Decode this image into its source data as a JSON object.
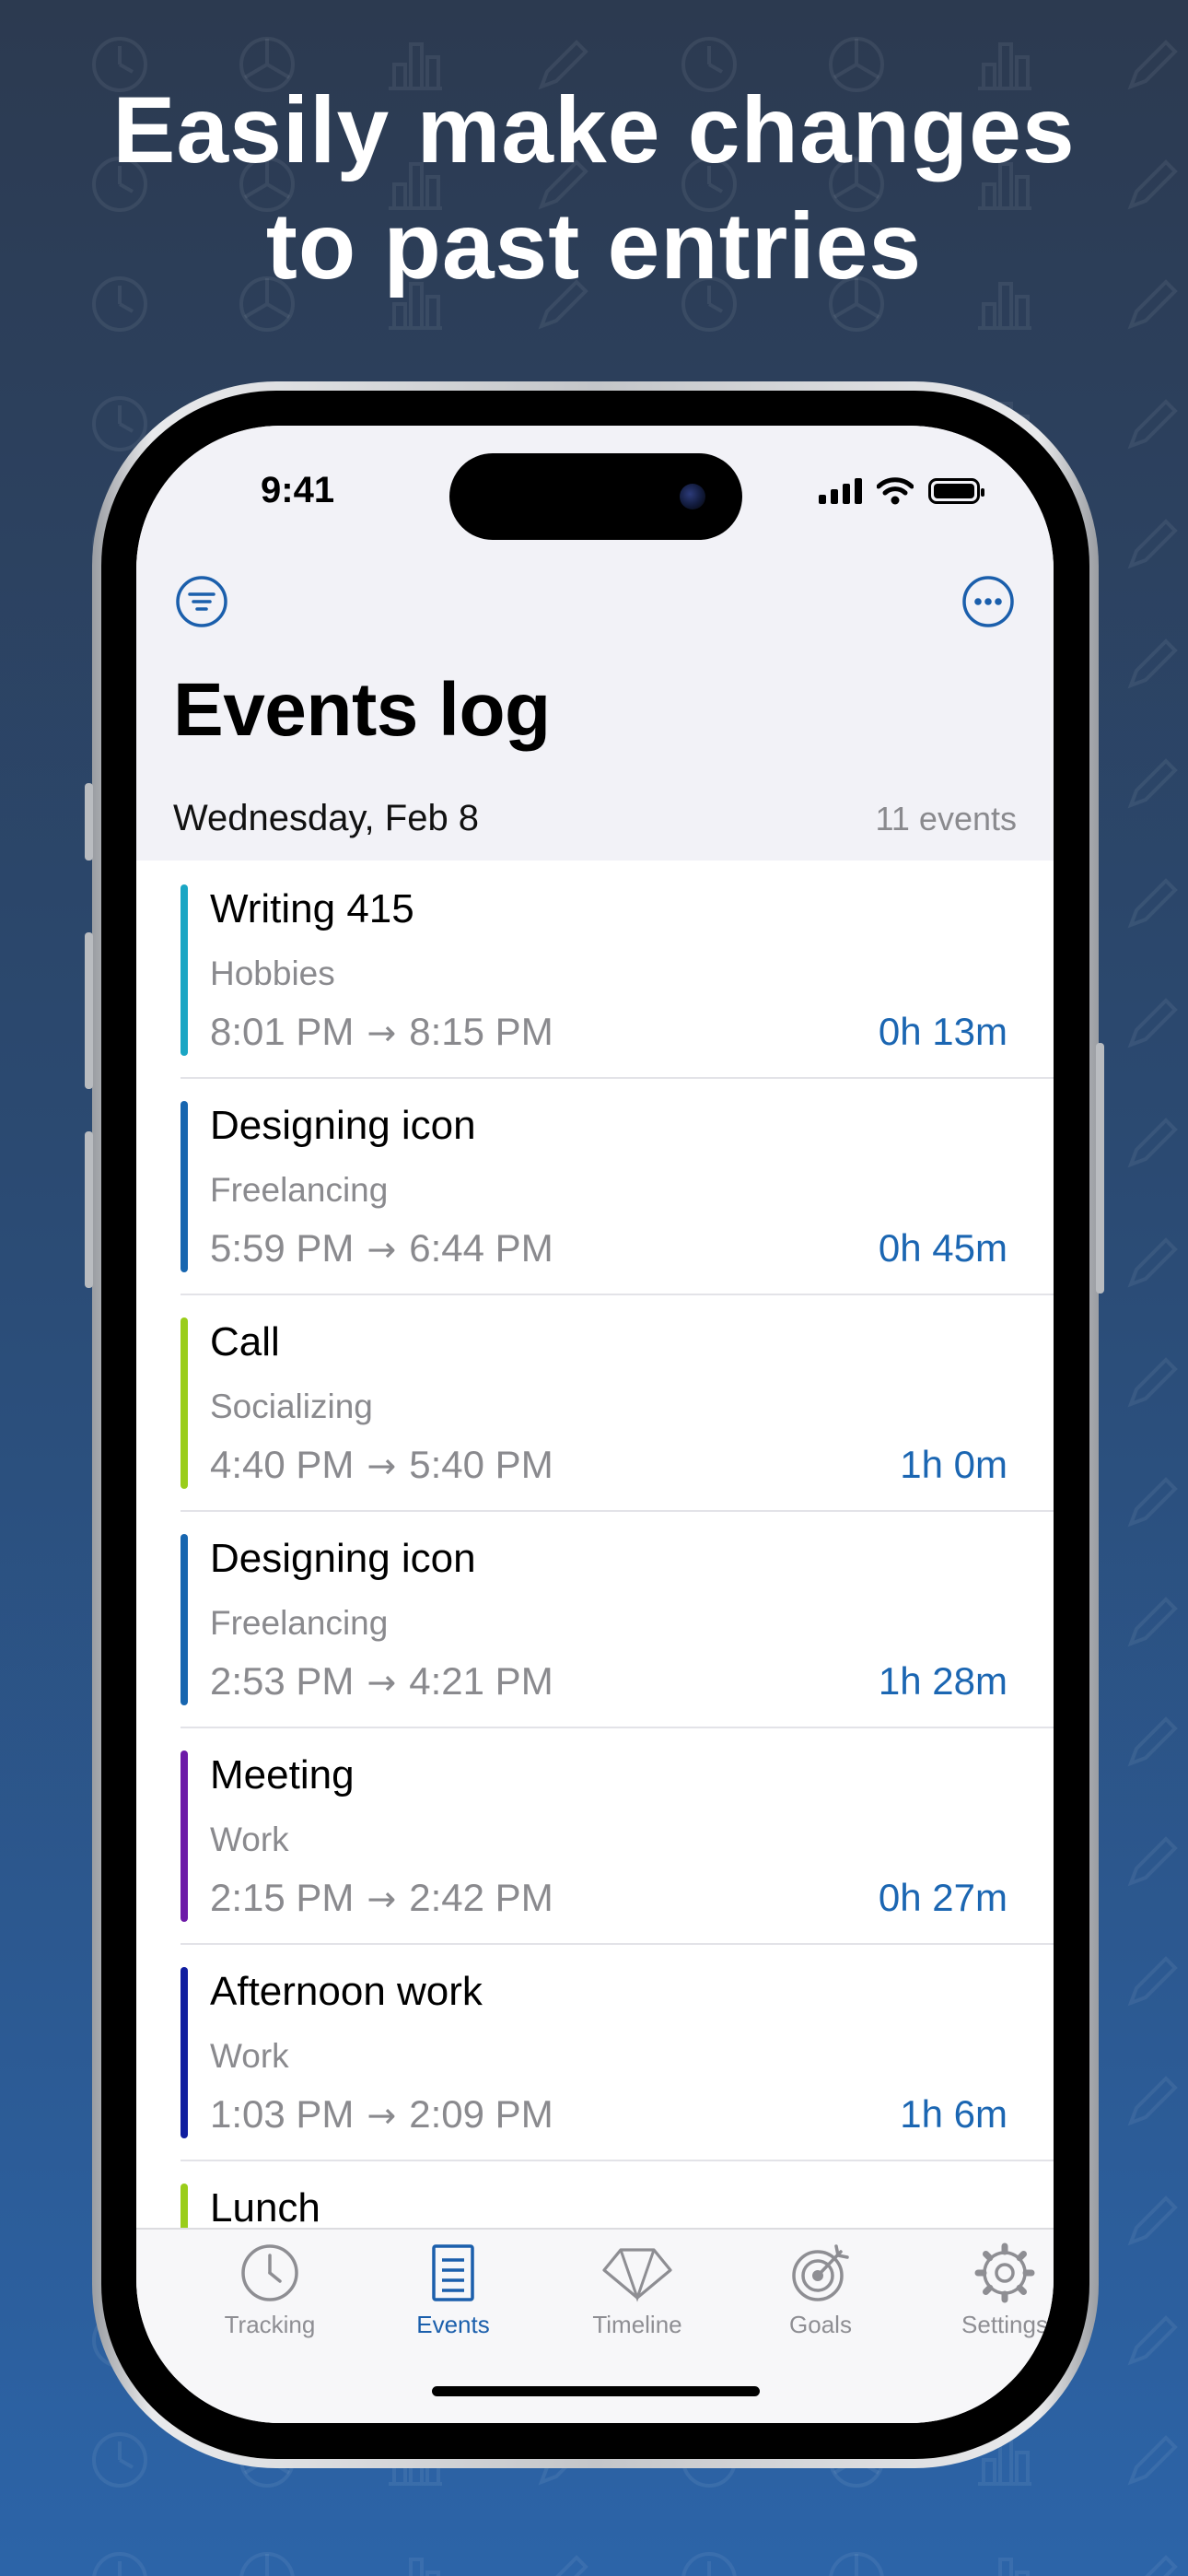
{
  "headline": {
    "line1": "Easily make changes",
    "line2": "to past entries"
  },
  "status_bar": {
    "time": "9:41"
  },
  "nav": {
    "left_icon": "filter-icon",
    "right_icon": "more-icon"
  },
  "page": {
    "title": "Events log"
  },
  "section": {
    "date": "Wednesday, Feb 8",
    "count": "11 events"
  },
  "events": [
    {
      "title": "Writing 415",
      "category": "Hobbies",
      "start": "8:01 PM",
      "end": "8:15 PM",
      "duration": "0h 13m",
      "color": "#1aa6c4"
    },
    {
      "title": "Designing icon",
      "category": "Freelancing",
      "start": "5:59 PM",
      "end": "6:44 PM",
      "duration": "0h 45m",
      "color": "#1766b0"
    },
    {
      "title": "Call",
      "category": "Socializing",
      "start": "4:40 PM",
      "end": "5:40 PM",
      "duration": "1h 0m",
      "color": "#9acd1a"
    },
    {
      "title": "Designing icon",
      "category": "Freelancing",
      "start": "2:53 PM",
      "end": "4:21 PM",
      "duration": "1h 28m",
      "color": "#1766b0"
    },
    {
      "title": "Meeting",
      "category": "Work",
      "start": "2:15 PM",
      "end": "2:42 PM",
      "duration": "0h 27m",
      "color": "#6d1aa8"
    },
    {
      "title": "Afternoon work",
      "category": "Work",
      "start": "1:03 PM",
      "end": "2:09 PM",
      "duration": "1h 6m",
      "color": "#101ea0"
    },
    {
      "title": "Lunch",
      "category": "",
      "start": "",
      "end": "",
      "duration": "",
      "color": "#9acd1a"
    }
  ],
  "tabs": [
    {
      "label": "Tracking",
      "icon": "clock-icon",
      "active": false
    },
    {
      "label": "Events",
      "icon": "list-icon",
      "active": true
    },
    {
      "label": "Timeline",
      "icon": "timeline-icon",
      "active": false
    },
    {
      "label": "Goals",
      "icon": "target-icon",
      "active": false
    },
    {
      "label": "Settings",
      "icon": "gear-icon",
      "active": false
    }
  ],
  "colors": {
    "accent": "#1b5fac",
    "duration": "#1b66b2",
    "secondary_text": "#8a8a8e"
  }
}
